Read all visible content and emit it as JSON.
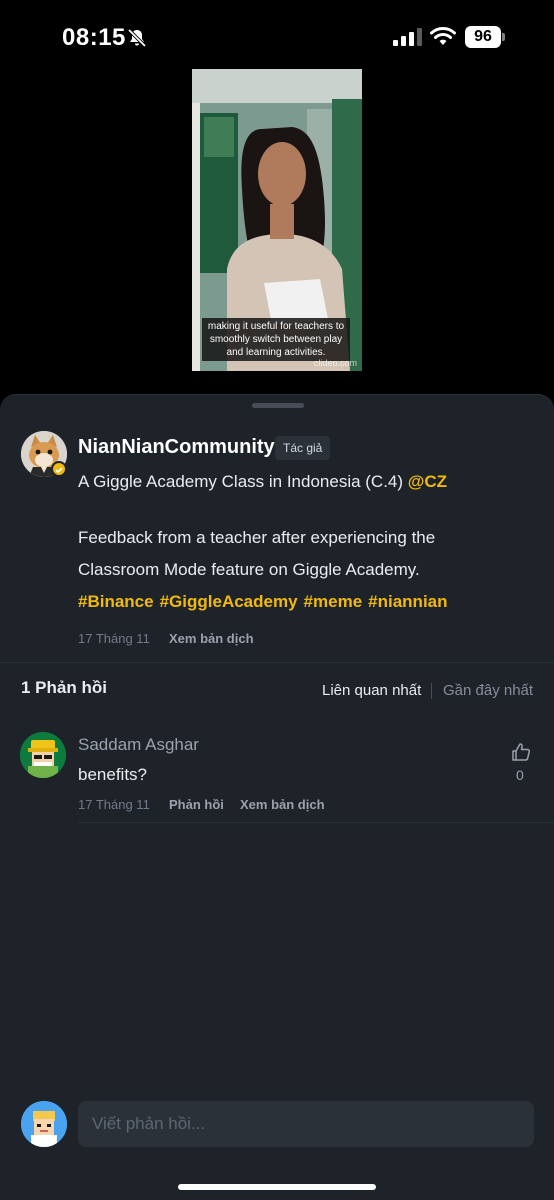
{
  "status_bar": {
    "time": "08:15",
    "battery": "96"
  },
  "video": {
    "caption": "making it useful for teachers to smoothly switch between play and learning activities.",
    "watermark": "clideo.com"
  },
  "post": {
    "author": "NianNianCommunity",
    "author_badge": "Tác giả",
    "title": "A Giggle Academy Class in Indonesia (C.4)",
    "mention": "@CZ",
    "body_line1": "Feedback from a teacher after experiencing the",
    "body_line2": "Classroom Mode feature on Giggle Academy.",
    "hashtags": [
      "#Binance",
      "#GiggleAcademy",
      "#meme",
      "#niannian"
    ],
    "date": "17 Tháng 11",
    "translate_label": "Xem bản dịch"
  },
  "replies": {
    "count_label": "1 Phản hồi",
    "sort_relevant": "Liên quan nhất",
    "sort_recent": "Gần đây nhất"
  },
  "comment": {
    "author": "Saddam Asghar",
    "text": "benefits?",
    "likes": "0",
    "date": "17 Tháng 11",
    "reply_label": "Phản hồi",
    "translate_label": "Xem bản dịch"
  },
  "composer": {
    "placeholder": "Viết phản hồi..."
  },
  "colors": {
    "accent": "#f0b90b",
    "sheet_bg": "#1e2329",
    "input_bg": "#2b3139"
  }
}
